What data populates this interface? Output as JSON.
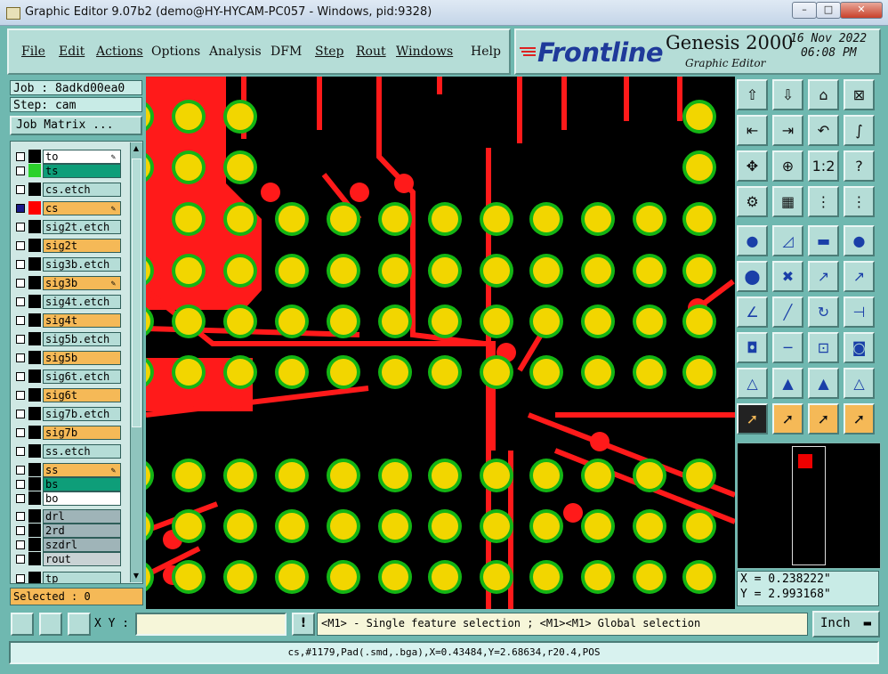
{
  "window": {
    "title": "Graphic Editor 9.07b2 (demo@HY-HYCAM-PC057 - Windows, pid:9328)",
    "controls": [
      "–",
      "□",
      "✕"
    ]
  },
  "menu": [
    "File",
    "Edit",
    "Actions",
    "Options",
    "Analysis",
    "DFM",
    "Step",
    "Rout",
    "Windows",
    "Help"
  ],
  "brand": {
    "logo": "Frontline",
    "product": "Genesis 2000",
    "subtitle": "Graphic Editor",
    "date": "16 Nov 2022",
    "time": "06:08 PM"
  },
  "job": {
    "label": "Job : 8adkd00ea0",
    "step": "Step: cam",
    "matrix_button": "Job Matrix ..."
  },
  "layers": [
    {
      "name": "to",
      "color": "#ffffff",
      "swatch": "#000000",
      "pen": true,
      "checked": false
    },
    {
      "name": "ts",
      "color": "#0e9e79",
      "swatch": "#2bd12b",
      "pen": false,
      "checked": false
    },
    {
      "name": "cs.etch",
      "color": "#b5ddd7",
      "swatch": "#000000",
      "pen": false,
      "checked": false
    },
    {
      "name": "cs",
      "color": "#f5b957",
      "swatch": "#ff0000",
      "pen": true,
      "checked": true
    },
    {
      "name": "sig2t.etch",
      "color": "#b5ddd7",
      "swatch": "#000000",
      "pen": false,
      "checked": false
    },
    {
      "name": "sig2t",
      "color": "#f5b957",
      "swatch": "#000000",
      "pen": false,
      "checked": false
    },
    {
      "name": "sig3b.etch",
      "color": "#b5ddd7",
      "swatch": "#000000",
      "pen": false,
      "checked": false
    },
    {
      "name": "sig3b",
      "color": "#f5b957",
      "swatch": "#000000",
      "pen": true,
      "checked": false
    },
    {
      "name": "sig4t.etch",
      "color": "#b5ddd7",
      "swatch": "#000000",
      "pen": false,
      "checked": false
    },
    {
      "name": "sig4t",
      "color": "#f5b957",
      "swatch": "#000000",
      "pen": false,
      "checked": false
    },
    {
      "name": "sig5b.etch",
      "color": "#b5ddd7",
      "swatch": "#000000",
      "pen": false,
      "checked": false
    },
    {
      "name": "sig5b",
      "color": "#f5b957",
      "swatch": "#000000",
      "pen": false,
      "checked": false
    },
    {
      "name": "sig6t.etch",
      "color": "#b5ddd7",
      "swatch": "#000000",
      "pen": false,
      "checked": false
    },
    {
      "name": "sig6t",
      "color": "#f5b957",
      "swatch": "#000000",
      "pen": false,
      "checked": false
    },
    {
      "name": "sig7b.etch",
      "color": "#b5ddd7",
      "swatch": "#000000",
      "pen": false,
      "checked": false
    },
    {
      "name": "sig7b",
      "color": "#f5b957",
      "swatch": "#000000",
      "pen": false,
      "checked": false
    },
    {
      "name": "ss.etch",
      "color": "#b5ddd7",
      "swatch": "#000000",
      "pen": false,
      "checked": false
    },
    {
      "name": "ss",
      "color": "#f5b957",
      "swatch": "#000000",
      "pen": true,
      "checked": false
    },
    {
      "name": "bs",
      "color": "#0e9e79",
      "swatch": "#000000",
      "pen": false,
      "checked": false
    },
    {
      "name": "bo",
      "color": "#ffffff",
      "swatch": "#000000",
      "pen": false,
      "checked": false
    },
    {
      "name": "drl",
      "color": "#9fb4b8",
      "swatch": "#000000",
      "pen": false,
      "checked": false
    },
    {
      "name": "2rd",
      "color": "#9fb4b8",
      "swatch": "#000000",
      "pen": false,
      "checked": false
    },
    {
      "name": "szdrl",
      "color": "#9fb4b8",
      "swatch": "#000000",
      "pen": false,
      "checked": false
    },
    {
      "name": "rout",
      "color": "#c9d2d4",
      "swatch": "#000000",
      "pen": false,
      "checked": false
    },
    {
      "name": "tp",
      "color": "#b5ddd7",
      "swatch": "#000000",
      "pen": false,
      "checked": false
    }
  ],
  "selected": "Selected : 0",
  "tools": [
    "layer-up-icon",
    "layer-down-icon",
    "home-icon",
    "zoom-window-icon",
    "pan-left-icon",
    "pan-right-icon",
    "undo-view-icon",
    "redraw-icon",
    "fit-icon",
    "zoom-center-icon",
    "scale-1-2-icon",
    "help-icon",
    "ruler-icon",
    "grid-icon",
    "snap-off-icon",
    "snap-on-icon",
    "add-pad-icon",
    "add-line-icon",
    "measure-icon",
    "add-surface-icon",
    "connect-icon",
    "delete-icon",
    "move-icon",
    "copy-icon",
    "slope-line-icon",
    "cut-line-icon",
    "rotate-icon",
    "mirror-icon",
    "align-icon",
    "stretch-icon",
    "resize-icon",
    "group-icon",
    "polygon-icon",
    "arc-icon",
    "cross-arc-icon",
    "angle-icon",
    "select-icon",
    "select-box-icon",
    "select-region-icon",
    "select-net-icon"
  ],
  "coords": {
    "x": "X = 0.238222\"",
    "y": "Y = 2.993168\""
  },
  "xy_label": "X Y :",
  "xy_value": "",
  "hint": "<M1> - Single feature selection ; <M1><M1> Global selection",
  "units": "Inch",
  "status": "cs,#1179,Pad(.smd,.bga),X=0.43484,Y=2.68634,r20.4,POS"
}
